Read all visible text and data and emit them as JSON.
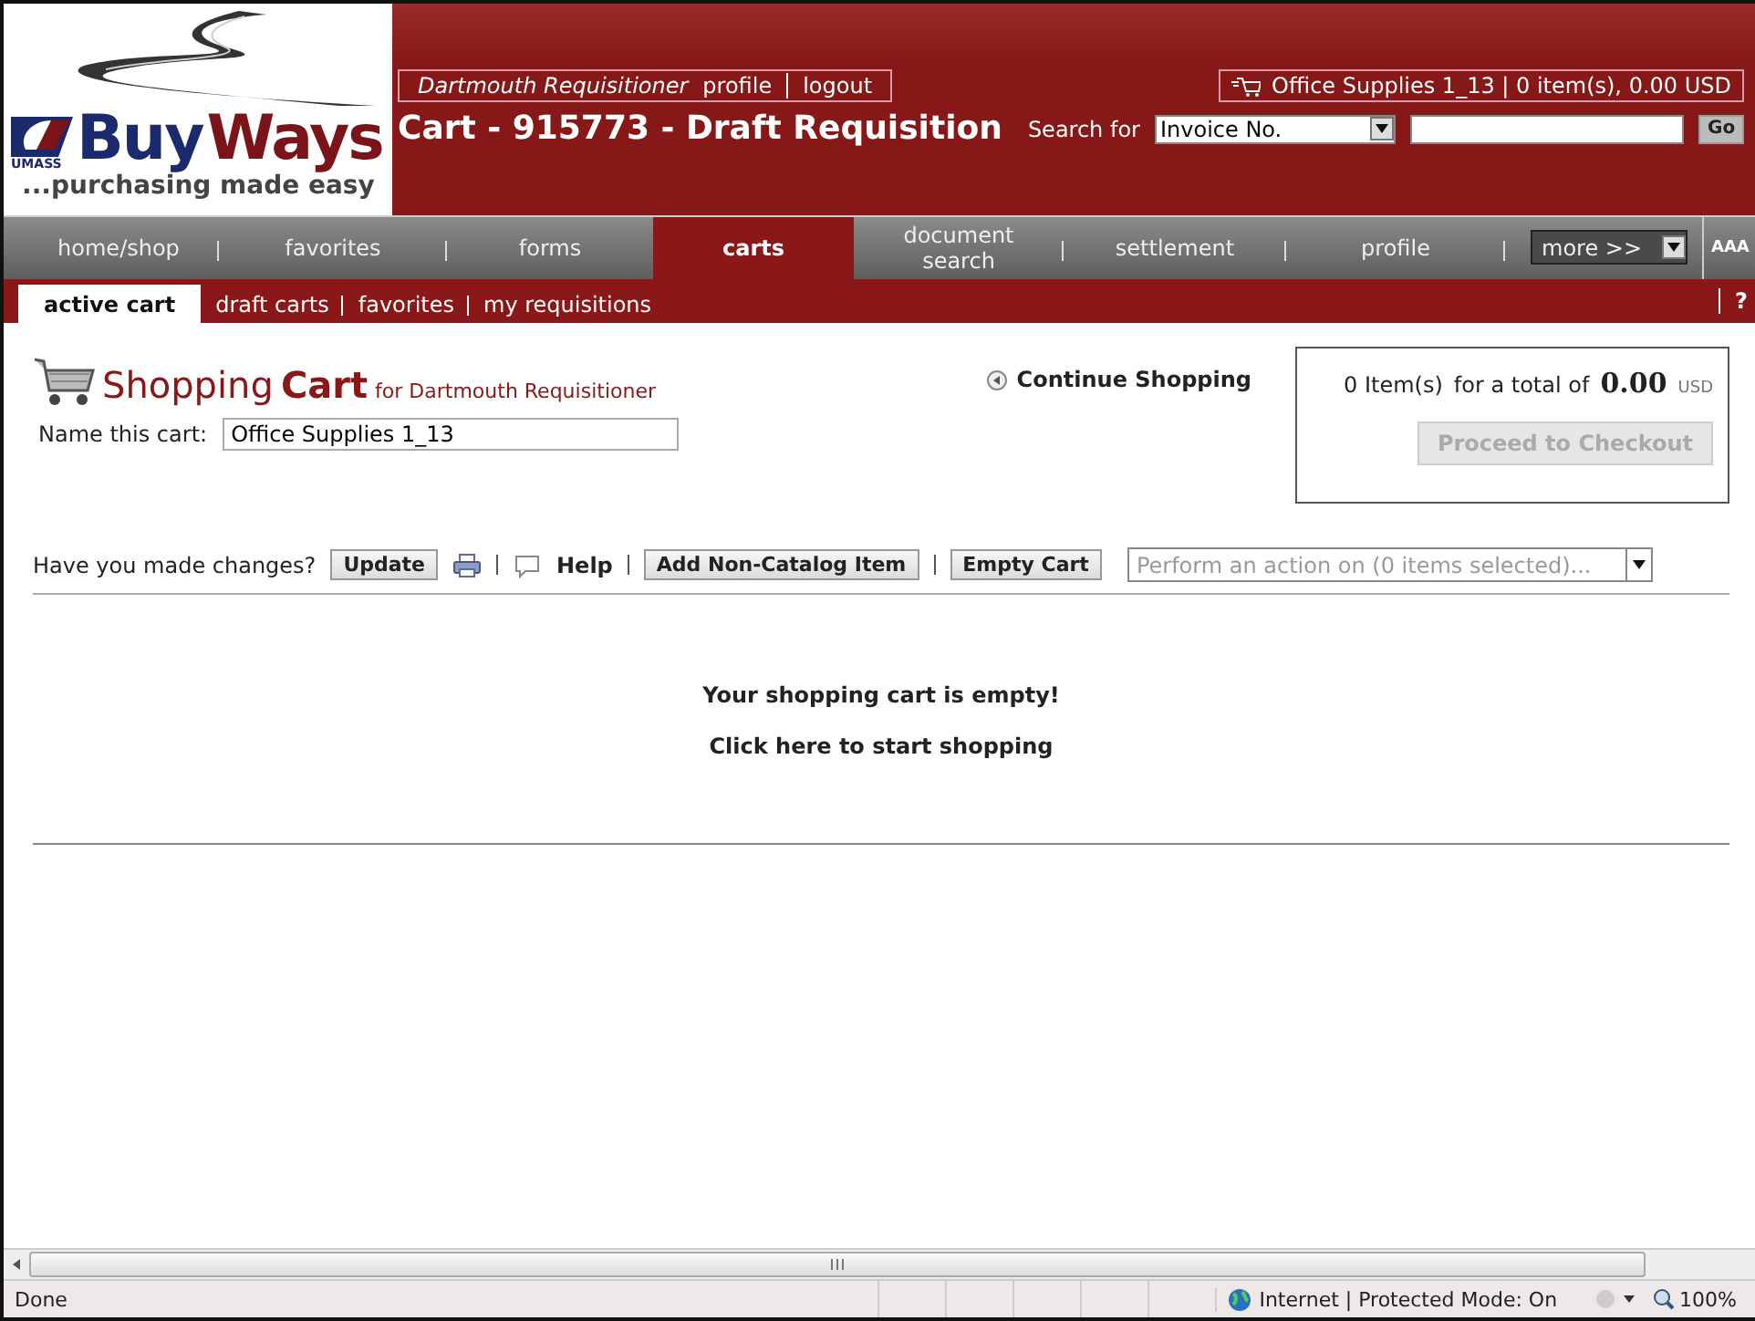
{
  "logo": {
    "brand_a": "Buy",
    "brand_b": "Ways",
    "org": "UMASS",
    "tagline": "...purchasing made easy"
  },
  "user_bar": {
    "user": "Dartmouth Requisitioner",
    "links": [
      "profile",
      "logout"
    ]
  },
  "cart_summary_bar": {
    "text": "Office Supplies 1_13 | 0 item(s), 0.00 USD"
  },
  "page_title": "Cart - 915773 - Draft Requisition",
  "search": {
    "label": "Search for",
    "type_value": "Invoice No.",
    "button": "Go"
  },
  "nav_tabs": [
    {
      "label": "home/shop",
      "selected": false
    },
    {
      "label": "favorites",
      "selected": false
    },
    {
      "label": "forms",
      "selected": false
    },
    {
      "label": "carts",
      "selected": true
    },
    {
      "label": "document search",
      "selected": false
    },
    {
      "label": "settlement",
      "selected": false
    },
    {
      "label": "profile",
      "selected": false
    }
  ],
  "more_menu": {
    "value": "more >>"
  },
  "text_size": "AAA",
  "sub_tabs": [
    {
      "label": "active cart",
      "selected": true
    },
    {
      "label": "draft carts",
      "selected": false
    },
    {
      "label": "favorites",
      "selected": false
    },
    {
      "label": "my requisitions",
      "selected": false
    }
  ],
  "help_button": "?",
  "cart": {
    "title_a": "Shopping",
    "title_b": "Cart",
    "owner": "for Dartmouth Requisitioner",
    "name_label": "Name this cart:",
    "name_value": "Office Supplies 1_13",
    "continue_link": "Continue Shopping"
  },
  "totals": {
    "items": "0 Item(s)",
    "total_label": "for a total of",
    "amount": "0.00",
    "currency": "USD",
    "checkout_button": "Proceed to Checkout",
    "checkout_disabled": true
  },
  "actions": {
    "prompt": "Have you made changes?",
    "update": "Update",
    "help": "Help",
    "add_item": "Add Non-Catalog Item",
    "empty_cart": "Empty Cart",
    "action_placeholder": "Perform an action on (0 items selected)..."
  },
  "empty_message": "Your shopping cart is empty!",
  "start_link": "Click here to start shopping",
  "status_bar": {
    "text": "Done",
    "zone": "Internet | Protected Mode: On",
    "zoom": "100%"
  }
}
